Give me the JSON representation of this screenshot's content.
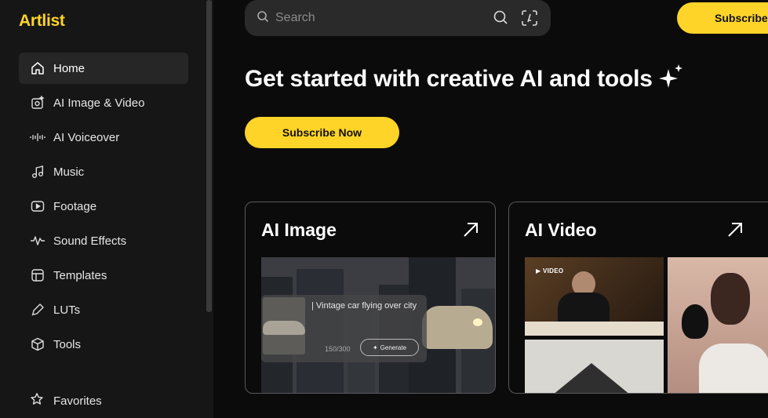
{
  "brand": {
    "logo": "Artlist",
    "accent": "#ffd428"
  },
  "sidebar": {
    "items": [
      {
        "label": "Home",
        "icon": "home-icon",
        "active": true
      },
      {
        "label": "AI Image & Video",
        "icon": "ai-image-video-icon"
      },
      {
        "label": "AI Voiceover",
        "icon": "waveform-icon"
      },
      {
        "label": "Music",
        "icon": "music-note-icon"
      },
      {
        "label": "Footage",
        "icon": "play-box-icon"
      },
      {
        "label": "Sound Effects",
        "icon": "pulse-icon"
      },
      {
        "label": "Templates",
        "icon": "template-icon"
      },
      {
        "label": "LUTs",
        "icon": "eyedropper-icon"
      },
      {
        "label": "Tools",
        "icon": "cube-icon"
      }
    ],
    "favorites": {
      "label": "Favorites",
      "icon": "star-icon"
    }
  },
  "search": {
    "placeholder": "Search"
  },
  "header": {
    "subscribe_label": "Subscribe"
  },
  "hero": {
    "headline": "Get started with creative AI and tools",
    "cta_label": "Subscribe Now"
  },
  "cards": [
    {
      "title": "AI Image",
      "prompt": "| Vintage car flying over city",
      "count": "150/300",
      "generate_label": "Generate"
    },
    {
      "title": "AI Video",
      "badge": "VIDEO"
    }
  ]
}
